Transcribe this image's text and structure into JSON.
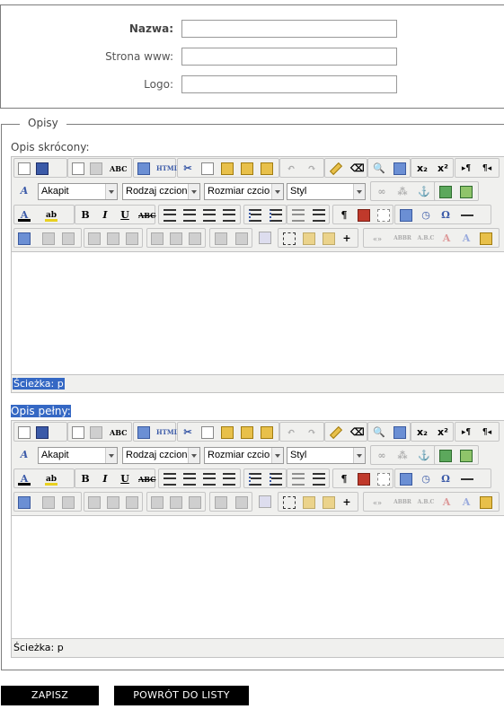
{
  "form": {
    "name_label": "Nazwa:",
    "name_value": "",
    "www_label": "Strona www:",
    "www_value": "",
    "logo_label": "Logo:",
    "logo_value": ""
  },
  "descriptions": {
    "legend": "Opisy",
    "short_label": "Opis skrócony:",
    "full_label": "Opis pełny:",
    "path_label": "Ścieżka: p"
  },
  "editor_selects": {
    "format": "Akapit",
    "font": "Rodzaj czcionk",
    "size": "Rozmiar czcion",
    "style": "Styl"
  },
  "toolbar_icons": {
    "row1": [
      "new-document-icon",
      "save-icon",
      "preview-icon",
      "print-icon",
      "spellcheck-icon",
      "template-icon",
      "html-icon",
      "cut-icon",
      "copy-icon",
      "paste-icon",
      "paste-text-icon",
      "paste-word-icon",
      "undo-icon",
      "redo-icon",
      "cleanup-icon",
      "remove-format-icon",
      "find-icon",
      "replace-icon",
      "subscript-icon",
      "superscript-icon",
      "ltr-icon",
      "rtl-icon"
    ],
    "row2": [
      "styles-icon",
      "link-icon",
      "unlink-icon",
      "anchor-icon",
      "media-icon",
      "image-icon"
    ],
    "row3": [
      "font-color-icon",
      "highlight-color-icon",
      "bold-icon",
      "italic-icon",
      "underline-icon",
      "strikethrough-icon",
      "align-left-icon",
      "align-center-icon",
      "align-right-icon",
      "justify-icon",
      "bullet-list-icon",
      "numbered-list-icon",
      "outdent-icon",
      "indent-icon",
      "pilcrow-icon",
      "nonbreaking-icon",
      "page-break-icon",
      "insert-date-icon",
      "insert-time-icon",
      "omega-icon",
      "horizontal-rule-icon"
    ],
    "row4": [
      "edit-css-icon",
      "table-row-props-icon",
      "table-cell-props-icon",
      "insert-row-before-icon",
      "insert-row-after-icon",
      "delete-row-icon",
      "insert-col-before-icon",
      "insert-col-after-icon",
      "delete-col-icon",
      "split-cells-icon",
      "merge-cells-icon",
      "insert-table-icon",
      "visual-aid-icon",
      "layer-back-icon",
      "layer-front-icon",
      "insert-layer-icon",
      "quote-icon",
      "abbr-icon",
      "acronym-icon",
      "del-icon",
      "ins-icon",
      "attribs-icon"
    ]
  },
  "buttons": {
    "save": "ZAPISZ",
    "back": "POWRÓT DO LISTY"
  },
  "colors": {
    "selection": "#3568c4",
    "button_bg": "#000000",
    "toolbar_bg": "#f0f0ee"
  }
}
